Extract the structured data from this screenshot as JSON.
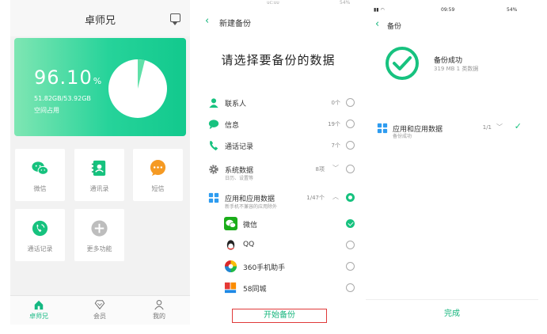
{
  "home": {
    "title": "卓师兄",
    "storage_percent": "96.10",
    "storage_unit": "%",
    "storage_size": "51.82GB/53.92GB",
    "storage_label": "空间占用",
    "storage_fraction": 0.961,
    "tiles": [
      {
        "label": "微信",
        "icon": "wechat-icon"
      },
      {
        "label": "通讯录",
        "icon": "contacts-icon"
      },
      {
        "label": "短信",
        "icon": "sms-icon"
      },
      {
        "label": "通话记录",
        "icon": "call-log-icon"
      },
      {
        "label": "更多功能",
        "icon": "plus-icon"
      }
    ],
    "nav": [
      {
        "label": "卓师兄",
        "icon": "home-icon"
      },
      {
        "label": "会员",
        "icon": "vip-icon"
      },
      {
        "label": "我的",
        "icon": "user-icon"
      }
    ]
  },
  "new_backup": {
    "status_center": "ᴜᴄ:ᴜᴜ",
    "status_right": "54%",
    "title": "新建备份",
    "heading": "请选择要备份的数据",
    "rows": [
      {
        "label": "联系人",
        "count": "0个"
      },
      {
        "label": "信息",
        "count": "19个"
      },
      {
        "label": "通话记录",
        "count": "7个"
      },
      {
        "label": "系统数据",
        "sub": "日历、设置等",
        "count": "8项"
      },
      {
        "label": "应用和应用数据",
        "sub": "新手机不兼容的应用除外",
        "count": "1/47个"
      }
    ],
    "apps": [
      {
        "label": "微信"
      },
      {
        "label": "QQ"
      },
      {
        "label": "360手机助手"
      },
      {
        "label": "58同城"
      }
    ],
    "start_button": "开始备份"
  },
  "backup_done": {
    "time": "09:59",
    "battery": "54%",
    "title": "备份",
    "success_title": "备份成功",
    "success_sub": "319 MB  1 类数据",
    "app_label": "应用和应用数据",
    "app_sub": "备份成功",
    "app_count": "1/1",
    "done_button": "完成"
  },
  "colors": {
    "accent": "#17c27f",
    "card_start": "#7fe6b3",
    "card_end": "#12c98d",
    "highlight": "#e03a3a"
  }
}
